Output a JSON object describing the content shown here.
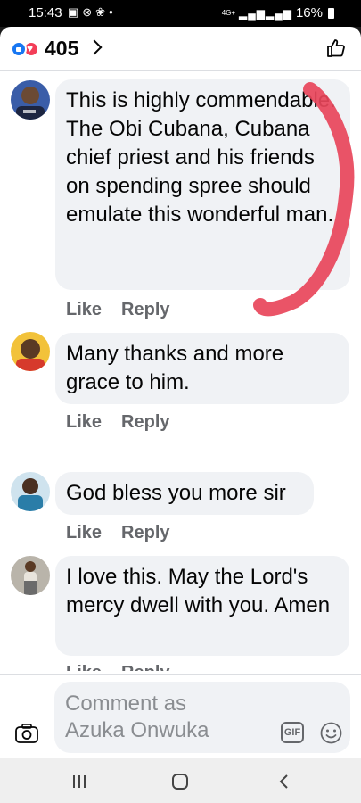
{
  "status_bar": {
    "time": "15:43",
    "network": "4G+",
    "battery": "16%",
    "icons": [
      "gallery-icon",
      "check-circle-icon",
      "fan-icon",
      "dot-icon",
      "signal-icon",
      "battery-icon"
    ]
  },
  "header": {
    "reaction_count": "405",
    "reactions": [
      "like",
      "love"
    ]
  },
  "comments": [
    {
      "text": "This is highly commendable. The Obi Cubana, Cubana chief priest and his friends on spending spree should emulate this wonderful man.",
      "like": "Like",
      "reply": "Reply"
    },
    {
      "text": "Many thanks and more grace to him.",
      "like": "Like",
      "reply": "Reply"
    },
    {
      "text": "God bless you more sir",
      "like": "Like",
      "reply": "Reply"
    },
    {
      "text": "I love this. May the Lord's mercy dwell with you. Amen",
      "like": "Like",
      "reply": "Reply"
    }
  ],
  "composer": {
    "placeholder": "Comment as Azuka Onwuka",
    "gif_label": "GIF"
  },
  "colors": {
    "accent": "#1877f2",
    "love": "#f33e58",
    "bubble": "#f0f2f5",
    "annotation": "#e8455a"
  }
}
